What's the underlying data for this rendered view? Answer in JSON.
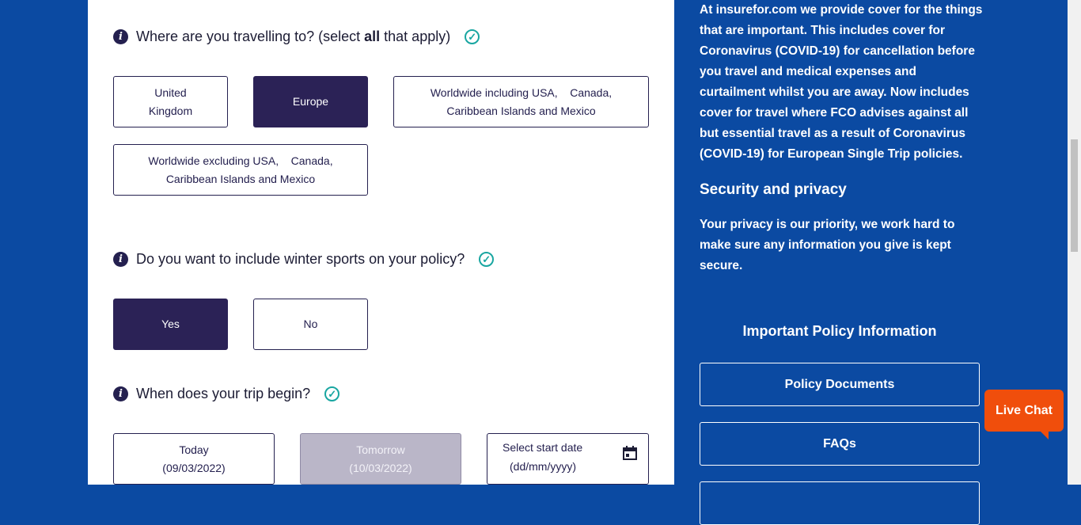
{
  "q1": {
    "text_before": "Where are you travelling to? (select ",
    "text_bold": "all",
    "text_after": " that apply)",
    "options": [
      {
        "line1": "United",
        "line2": "Kingdom"
      },
      {
        "label": "Europe"
      },
      {
        "line1": "Worldwide including USA,    Canada,",
        "line2": "Caribbean Islands and Mexico"
      },
      {
        "line1": "Worldwide excluding USA,    Canada,",
        "line2": "Caribbean Islands and Mexico"
      }
    ]
  },
  "q2": {
    "text": "Do you want to include winter sports on your policy?",
    "yes": "Yes",
    "no": "No"
  },
  "q3": {
    "text": "When does your trip begin?",
    "today_label": "Today",
    "today_date": "(09/03/2022)",
    "tomorrow_label": "Tomorrow",
    "tomorrow_date": "(10/03/2022)",
    "date_placeholder_1": "Select start date",
    "date_placeholder_2": "(dd/mm/yyyy)"
  },
  "sidebar": {
    "cover_text": "At insurefor.com we provide cover for the things that are important. This includes cover for Coronavirus (COVID-19) for cancellation before you travel and medical expenses and curtailment whilst you are away. Now includes cover for travel where FCO advises against all but essential travel as a result of Coronavirus (COVID-19) for European Single Trip policies.",
    "security_heading": "Security and privacy",
    "security_text": "Your privacy is our priority, we work hard to make sure any information you give is kept secure.",
    "policy_heading": "Important Policy Information",
    "policy_documents": "Policy Documents",
    "faqs": "FAQs"
  },
  "live_chat": "Live Chat",
  "icons": {
    "info": "info-icon",
    "check": "check-circle-icon",
    "calendar": "calendar-icon"
  },
  "colors": {
    "brand_blue": "#0b4aa2",
    "dark_purple": "#2b2256",
    "teal": "#19a6a1",
    "orange": "#f04e0c"
  }
}
